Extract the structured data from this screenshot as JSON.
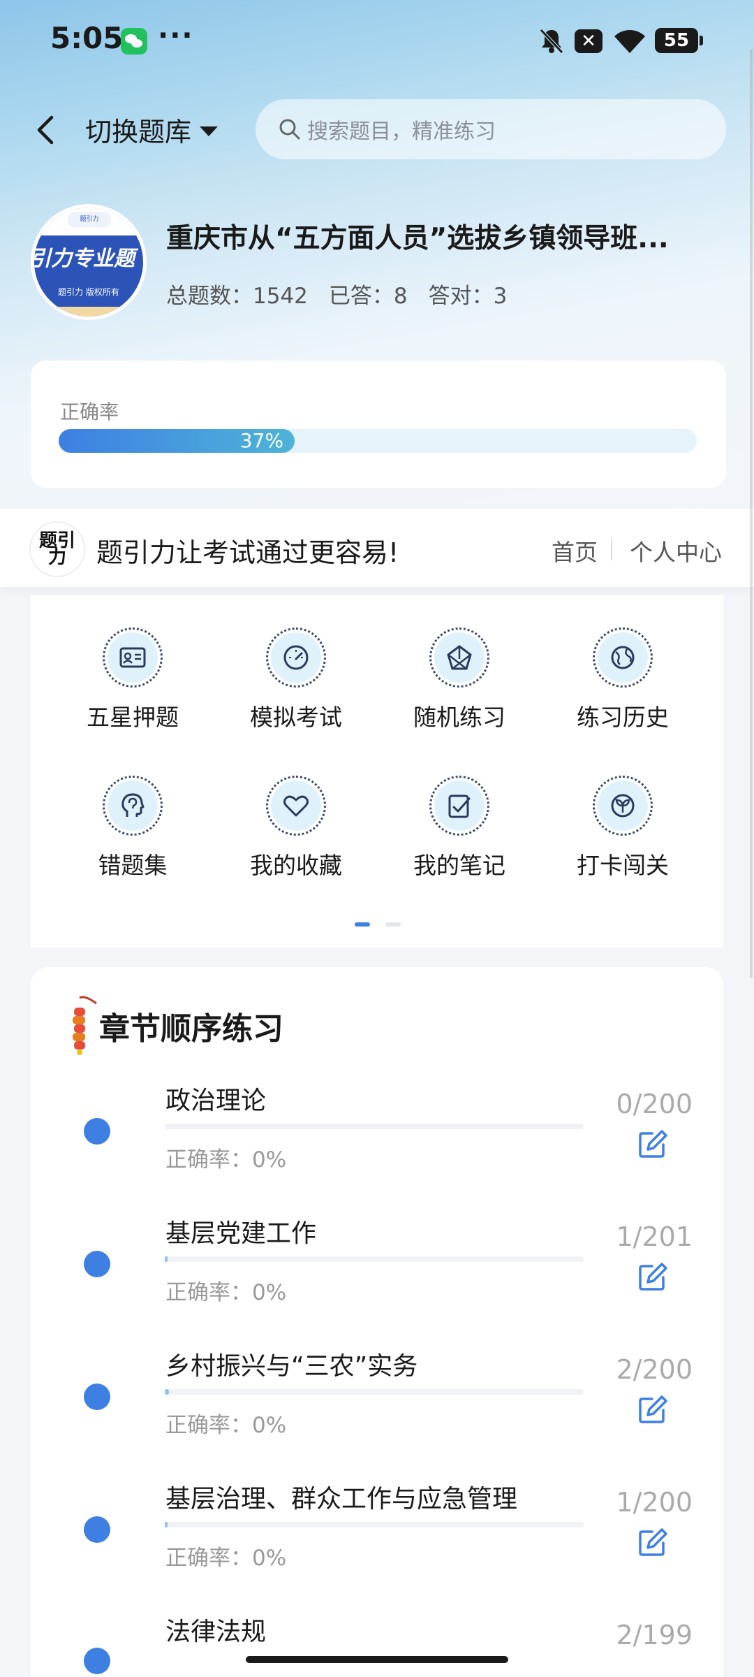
{
  "status_bar": {
    "time": "5:05",
    "more": "···",
    "notification": "✕",
    "battery": "55"
  },
  "header": {
    "bank_switch_label": "切换题库",
    "search_placeholder": "搜索题目，精准练习"
  },
  "bank": {
    "logo_top": "题引力",
    "logo_text": "引力专业题",
    "logo_sub": "题引力 版权所有",
    "title": "重庆市从“五方面人员”选拔乡镇领导班...",
    "stats": {
      "total": "总题数：1542",
      "answered": "已答：8",
      "correct": "答对：3"
    }
  },
  "accuracy": {
    "label": "正确率",
    "value_text": "37%",
    "value": 0.37
  },
  "slogan": {
    "logo_text": "题引力",
    "text": "题引力让考试通过更容易!",
    "nav_home": "首页",
    "nav_me": "个人中心"
  },
  "features": [
    {
      "label": "五星押题",
      "icon": "id-card-icon"
    },
    {
      "label": "模拟考试",
      "icon": "gauge-icon"
    },
    {
      "label": "随机练习",
      "icon": "network-icon"
    },
    {
      "label": "练习历史",
      "icon": "globe-icon"
    },
    {
      "label": "错题集",
      "icon": "brain-head-icon"
    },
    {
      "label": "我的收藏",
      "icon": "heart-icon"
    },
    {
      "label": "我的笔记",
      "icon": "note-check-icon"
    },
    {
      "label": "打卡闯关",
      "icon": "sprout-icon"
    }
  ],
  "chapter_section": {
    "title": "章节顺序练习",
    "items": [
      {
        "name": "政治理论",
        "accuracy": "正确率：0%",
        "count": "0/200",
        "progress": 0.0
      },
      {
        "name": "基层党建工作",
        "accuracy": "正确率：0%",
        "count": "1/201",
        "progress": 0.005
      },
      {
        "name": "乡村振兴与“三农”实务",
        "accuracy": "正确率：0%",
        "count": "2/200",
        "progress": 0.01
      },
      {
        "name": "基层治理、群众工作与应急管理",
        "accuracy": "正确率：0%",
        "count": "1/200",
        "progress": 0.005
      },
      {
        "name": "法律法规",
        "accuracy": "",
        "count": "2/199",
        "progress": 0.01
      }
    ]
  },
  "colors": {
    "accent": "#3d7fe3",
    "teal": "#4fb4d8"
  }
}
